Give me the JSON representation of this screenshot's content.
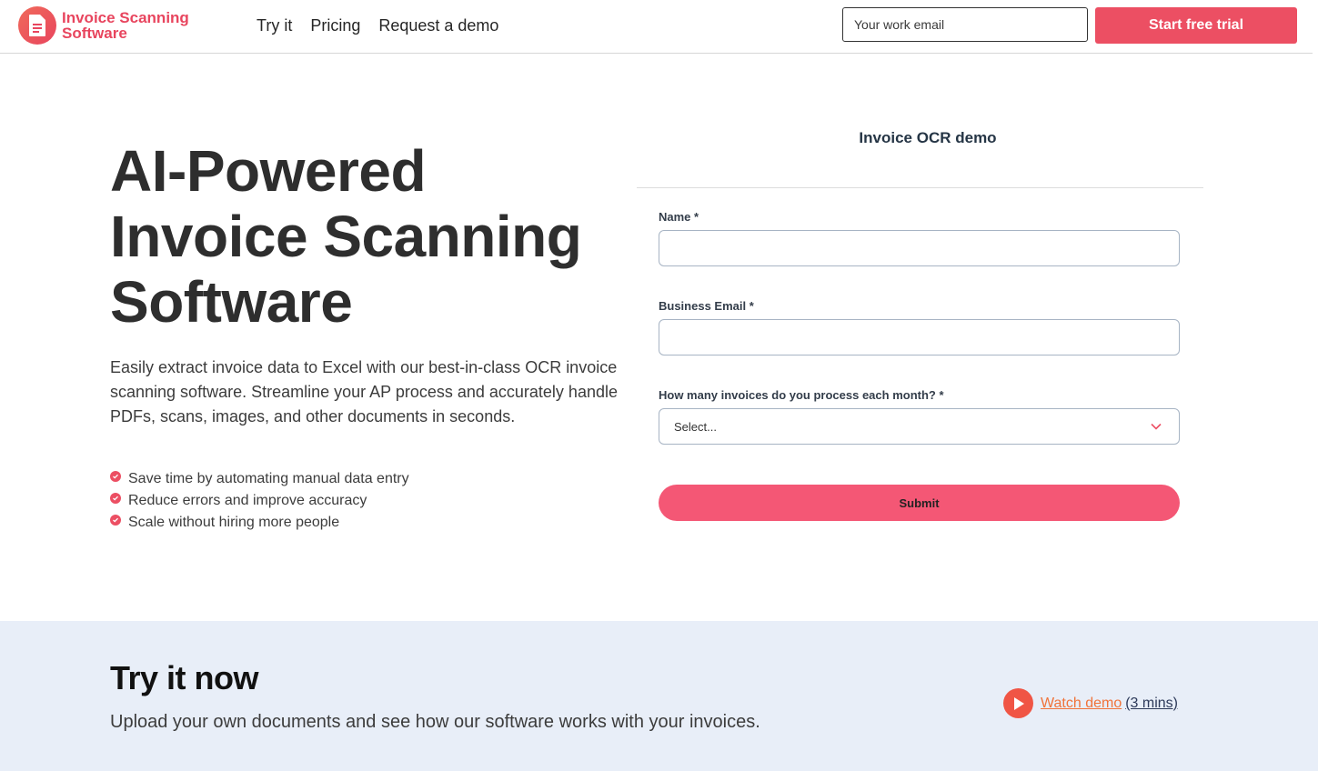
{
  "header": {
    "logo_line1": "Invoice Scanning",
    "logo_line2": "Software",
    "nav": [
      "Try it",
      "Pricing",
      "Request a demo"
    ],
    "email_placeholder": "Your work email",
    "trial_label": "Start free trial"
  },
  "hero": {
    "title_line1": "AI-Powered",
    "title_line2": "Invoice Scanning",
    "title_line3": "Software",
    "description": "Easily extract invoice data to Excel with our best-in-class OCR invoice scanning software. Streamline your AP process and accurately handle PDFs, scans, images, and other documents in seconds.",
    "bullets": [
      "Save time by automating manual data entry",
      "Reduce errors and improve accuracy",
      "Scale without hiring more people"
    ]
  },
  "form": {
    "title": "Invoice OCR demo",
    "name_label": "Name *",
    "email_label": "Business Email *",
    "invoices_label": "How many invoices do you process each month? *",
    "select_value": "Select...",
    "submit_label": "Submit"
  },
  "try_section": {
    "title": "Try it now",
    "description": "Upload your own documents and see how our software works with your invoices.",
    "watch_label": "Watch demo ",
    "watch_duration": "(3 mins)"
  },
  "colors": {
    "brand": "#e8455e",
    "cta": "#ec4f63",
    "submit": "#f45775",
    "section_bg": "#e8eef8",
    "link_orange": "#f0733a"
  },
  "icons": [
    "document-logo-icon",
    "check-bullet-icon",
    "chevron-down-icon",
    "play-icon"
  ]
}
